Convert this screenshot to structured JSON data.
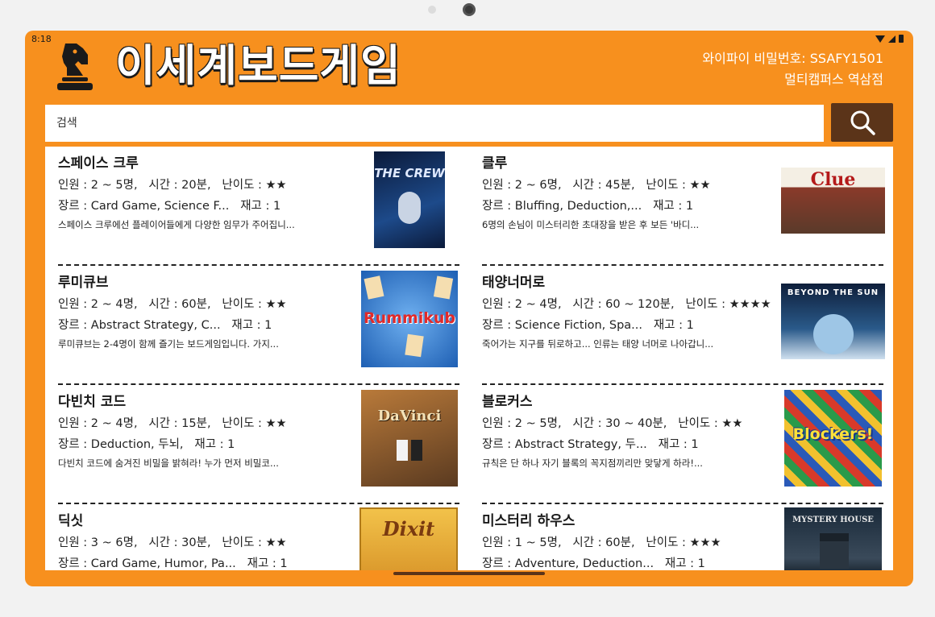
{
  "status": {
    "time": "8:18"
  },
  "header": {
    "title": "이세계보드게임",
    "wifi_password": "와이파이 비밀번호: SSAFY1501",
    "branch": "멀티캠퍼스 역삼점"
  },
  "search": {
    "placeholder": "검색",
    "value": ""
  },
  "games": [
    {
      "title": "스페이스 크루",
      "players": "인원 : 2 ~ 5명,",
      "time": "시간 : 20분,",
      "difficulty": "난이도 : ★★",
      "genre": "장르 : Card Game, Science F...",
      "stock": "재고 : 1",
      "desc": "스페이스 크루에선 플레이어들에게 다양한 임무가 주어집니...",
      "cover_text": "THE CREW"
    },
    {
      "title": "클루",
      "players": "인원 : 2 ~ 6명,",
      "time": "시간 : 45분,",
      "difficulty": "난이도 : ★★",
      "genre": "장르 : Bluffing, Deduction,...",
      "stock": "재고 : 1",
      "desc": "6명의 손님이 미스터리한 초대장을 받은 후 보든 '바디...",
      "cover_text": "Clue"
    },
    {
      "title": "루미큐브",
      "players": "인원 : 2 ~ 4명,",
      "time": "시간 : 60분,",
      "difficulty": "난이도 : ★★",
      "genre": "장르 : Abstract Strategy, C...",
      "stock": "재고 : 1",
      "desc": "루미큐브는 2-4명이 함께 즐기는 보드게임입니다. 가지...",
      "cover_text": "Rummikub"
    },
    {
      "title": "태양너머로",
      "players": "인원 : 2 ~ 4명,",
      "time": "시간 : 60 ~ 120분,",
      "difficulty": "난이도 : ★★★★",
      "genre": "장르 : Science Fiction, Spa...",
      "stock": "재고 : 1",
      "desc": "죽어가는 지구를 뒤로하고... 인류는 태양 너머로 나아갑니...",
      "cover_text": "BEYOND THE SUN"
    },
    {
      "title": "다빈치 코드",
      "players": "인원 : 2 ~ 4명,",
      "time": "시간 : 15분,",
      "difficulty": "난이도 : ★★",
      "genre": "장르 : Deduction, 두뇌,",
      "stock": "재고 : 1",
      "desc": "다빈치 코드에 숨겨진 비밀을 밝혀라! 누가 먼저 비밀코...",
      "cover_text": "DaVinci"
    },
    {
      "title": "블로커스",
      "players": "인원 : 2 ~ 5명,",
      "time": "시간 : 30 ~ 40분,",
      "difficulty": "난이도 : ★★",
      "genre": "장르 : Abstract Strategy, 두...",
      "stock": "재고 : 1",
      "desc": "규칙은 단 하나 자기 블록의 꼭지점끼리만 맞닿게 하라!...",
      "cover_text": "Blockers!"
    },
    {
      "title": "딕싯",
      "players": "인원 : 3 ~ 6명,",
      "time": "시간 : 30분,",
      "difficulty": "난이도 : ★★",
      "genre": "장르 : Card Game, Humor, Pa...",
      "stock": "재고 : 1",
      "desc": "",
      "cover_text": "Dixit"
    },
    {
      "title": "미스터리 하우스",
      "players": "인원 : 1 ~ 5명,",
      "time": "시간 : 60분,",
      "difficulty": "난이도 : ★★★",
      "genre": "장르 : Adventure, Deduction...",
      "stock": "재고 : 1",
      "desc": "",
      "cover_text": "MYSTERY HOUSE"
    }
  ],
  "colors": {
    "primary": "#f7901e",
    "search_button": "#5b3419",
    "text": "#1a1a1a"
  }
}
